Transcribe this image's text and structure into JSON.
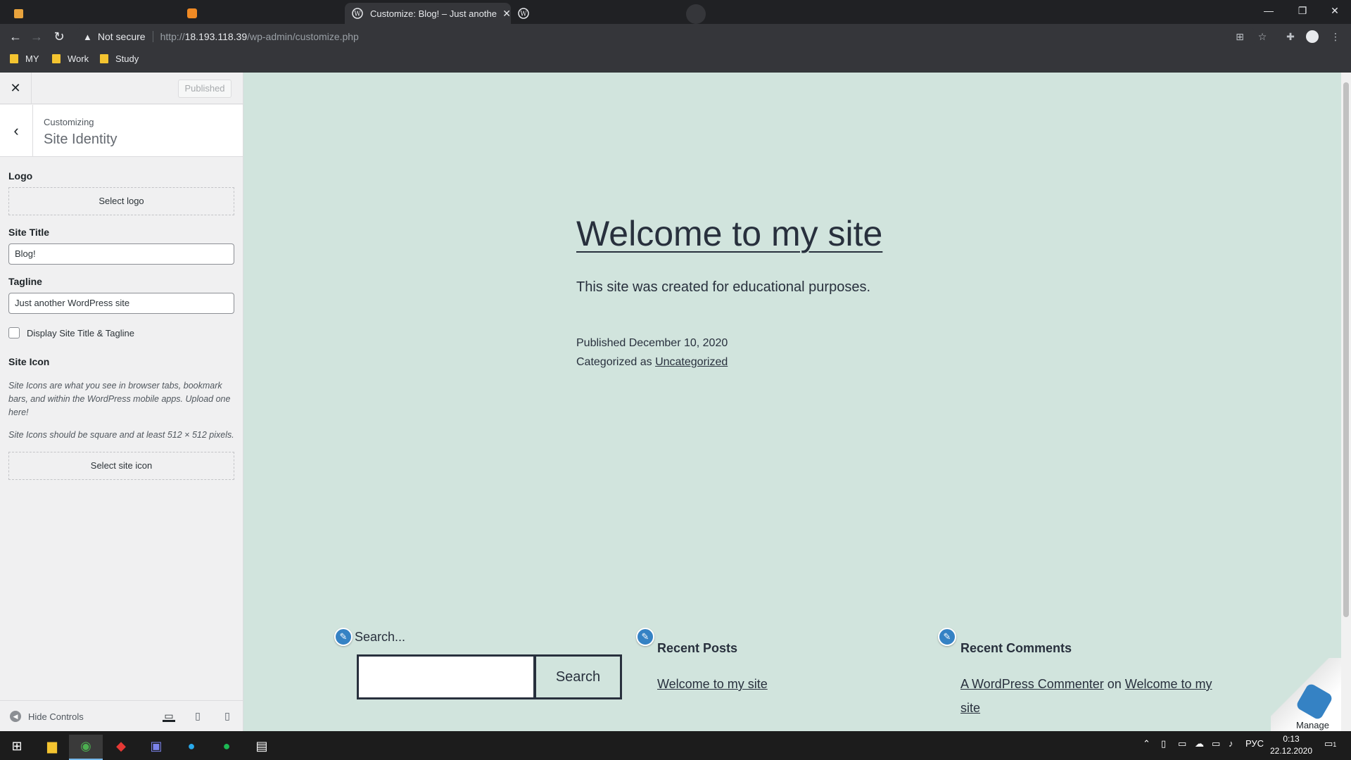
{
  "browser": {
    "tabs": [
      {
        "title": ""
      },
      {
        "title": ""
      },
      {
        "title": "Customize: Blog! – Just another WordPress site"
      },
      {
        "title": ""
      }
    ],
    "window_controls": {
      "minimize": "—",
      "restore": "❐",
      "close": "✕"
    },
    "security_label": "Not secure",
    "url": {
      "prefix": "http://",
      "host": "18.193.118.39",
      "path": "/wp-admin/customize.php"
    },
    "bookmarks": [
      "MY",
      "Work",
      "Study"
    ]
  },
  "customizer": {
    "published_label": "Published",
    "customizing_label": "Customizing",
    "section_title": "Site Identity",
    "logo_label": "Logo",
    "select_logo": "Select logo",
    "site_title_label": "Site Title",
    "site_title_value": "Blog!",
    "tagline_label": "Tagline",
    "tagline_value": "Just another WordPress site",
    "display_checkbox_label": "Display Site Title & Tagline",
    "site_icon_label": "Site Icon",
    "site_icon_desc1": "Site Icons are what you see in browser tabs, bookmark bars, and within the WordPress mobile apps. Upload one here!",
    "site_icon_desc2": "Site Icons should be square and at least 512 × 512 pixels.",
    "select_site_icon": "Select site icon",
    "hide_controls": "Hide Controls"
  },
  "preview": {
    "heading": "Welcome to my site",
    "description": "This site was created for educational purposes.",
    "published": "Published December 10, 2020",
    "categorized_prefix": "Categorized as",
    "category": "Uncategorized",
    "search_label": "Search...",
    "search_button": "Search",
    "recent_posts_title": "Recent Posts",
    "recent_post_item": "Welcome to my site",
    "recent_comments_title": "Recent Comments",
    "comment_author": "A WordPress Commenter",
    "comment_on": "on",
    "comment_post_line1": "Welcome to my",
    "comment_post_line2": "site",
    "manage_label": "Manage"
  },
  "taskbar": {
    "tray_lang": "РУС",
    "time": "0:13",
    "date": "22.12.2020",
    "notification_count": "1"
  },
  "colors": {
    "preview_bg": "#d1e4dd",
    "text": "#28303d",
    "accent": "#3582c4"
  }
}
